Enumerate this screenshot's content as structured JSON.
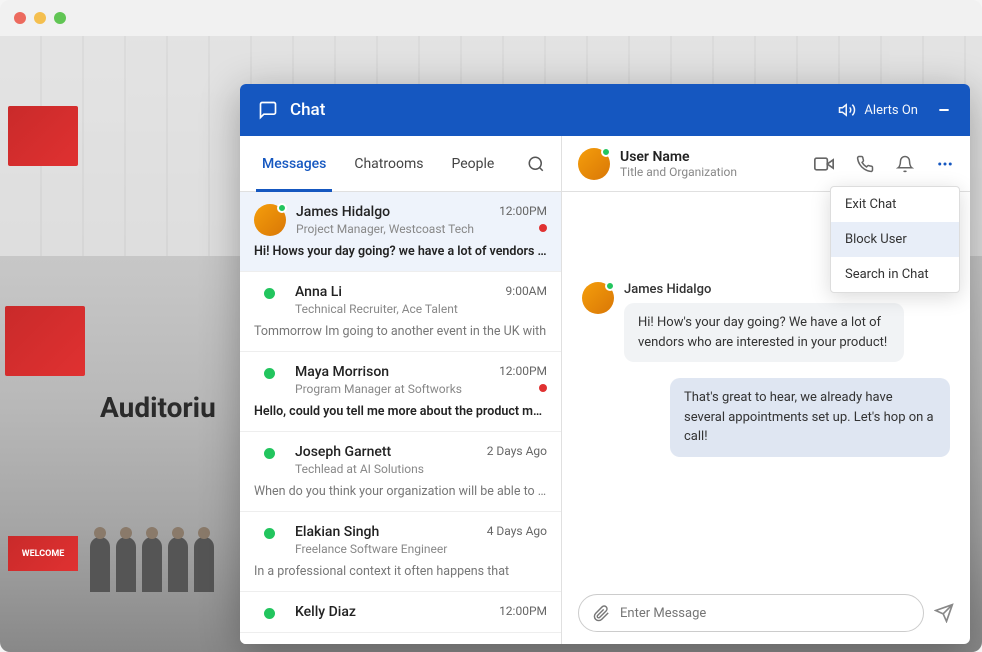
{
  "chat": {
    "title": "Chat",
    "alerts_label": "Alerts On"
  },
  "tabs": {
    "messages": "Messages",
    "chatrooms": "Chatrooms",
    "people": "People"
  },
  "conversations": [
    {
      "name": "James Hidalgo",
      "sub": "Project Manager, Westcoast Tech",
      "time": "12:00PM",
      "preview": "Hi! Hows your day going? we have a lot of vendors wh..",
      "avatar": true,
      "unread": true,
      "bold": true
    },
    {
      "name": "Anna Li",
      "sub": "Technical Recruiter, Ace Talent",
      "time": "9:00AM",
      "preview": "Tommorrow Im going to another event in the UK with",
      "bold": false
    },
    {
      "name": "Maya Morrison",
      "sub": "Program Manager at Softworks",
      "time": "12:00PM",
      "preview": "Hello, could you tell me more about the product mana..",
      "unread": true,
      "bold": true
    },
    {
      "name": "Joseph Garnett",
      "sub": "Techlead at AI Solutions",
      "time": "2 Days Ago",
      "preview": "When do you think your organization will be able to int..",
      "bold": false
    },
    {
      "name": "Elakian Singh",
      "sub": "Freelance Software Engineer",
      "time": "4 Days Ago",
      "preview": "In a professional context it often happens that",
      "bold": false
    },
    {
      "name": "Kelly Diaz",
      "sub": "",
      "time": "12:00PM",
      "preview": "",
      "bold": false
    }
  ],
  "active_user": {
    "name": "User Name",
    "sub": "Title and Organization"
  },
  "dropdown": {
    "exit": "Exit Chat",
    "block": "Block User",
    "search": "Search in Chat"
  },
  "thread": {
    "sender": "James Hidalgo",
    "incoming": "Hi! How's your day going? We have a lot of vendors who are interested in your product!",
    "outgoing": "That's great to hear, we already have several appointments set up. Let's hop on a call!"
  },
  "composer": {
    "placeholder": "Enter Message"
  },
  "bg": {
    "auditorium": "Auditoriu",
    "welcome": "WELCOME"
  }
}
